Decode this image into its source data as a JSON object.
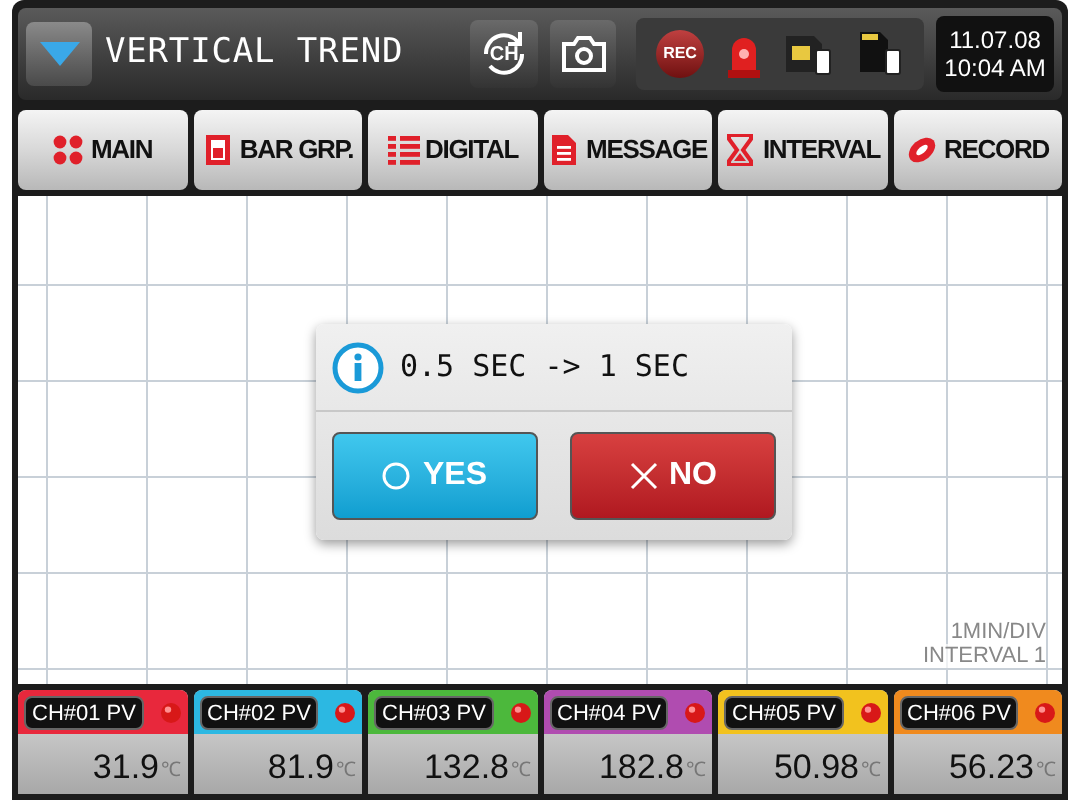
{
  "header": {
    "title": "VERTICAL TREND",
    "ch_button": "CH",
    "date": "11.07.08",
    "time": "10:04 AM",
    "rec_badge": "REC"
  },
  "nav": [
    {
      "label": "MAIN"
    },
    {
      "label": "BAR GRP."
    },
    {
      "label": "DIGITAL"
    },
    {
      "label": "MESSAGE"
    },
    {
      "label": "INTERVAL"
    },
    {
      "label": "RECORD"
    }
  ],
  "trend": {
    "scale": "1MIN/DIV",
    "interval": "INTERVAL 1"
  },
  "dialog": {
    "message": "0.5 SEC -> 1 SEC",
    "buttons": [
      {
        "label": "YES",
        "kind": "yes"
      },
      {
        "label": "NO",
        "kind": "no"
      }
    ]
  },
  "channels": [
    {
      "label": "CH#01 PV",
      "value": "31.9",
      "unit": "℃",
      "color": "#e8283c"
    },
    {
      "label": "CH#02 PV",
      "value": "81.9",
      "unit": "℃",
      "color": "#2cb8e2"
    },
    {
      "label": "CH#03 PV",
      "value": "132.8",
      "unit": "℃",
      "color": "#4cb83c"
    },
    {
      "label": "CH#04 PV",
      "value": "182.8",
      "unit": "℃",
      "color": "#b04cb0"
    },
    {
      "label": "CH#05 PV",
      "value": "50.98",
      "unit": "℃",
      "color": "#f2c21e"
    },
    {
      "label": "CH#06 PV",
      "value": "56.23",
      "unit": "℃",
      "color": "#f08a1e"
    }
  ]
}
